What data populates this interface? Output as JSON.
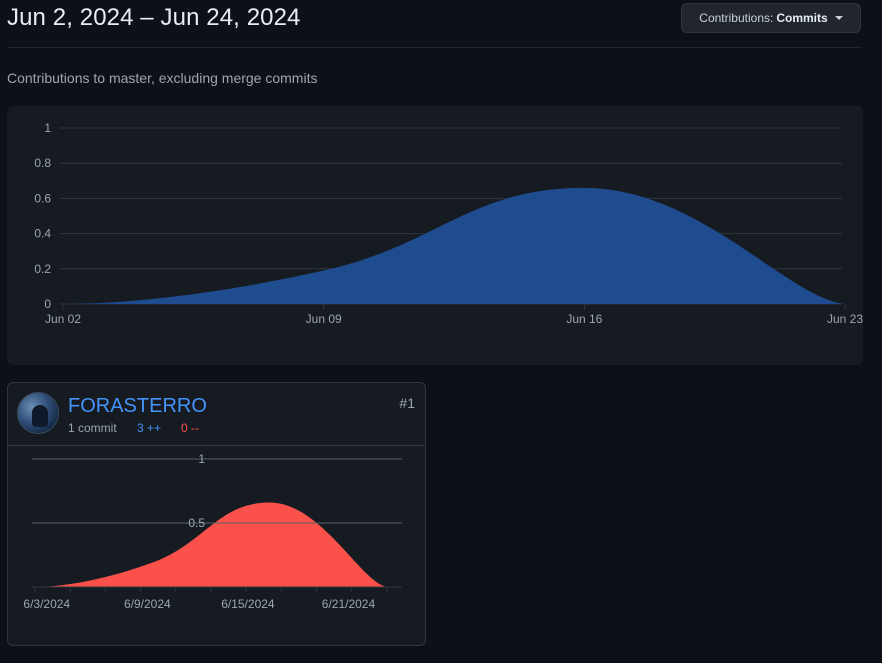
{
  "header": {
    "title": "Jun 2, 2024 – Jun 24, 2024",
    "contributions_prefix": "Contributions:",
    "contributions_value": "Commits"
  },
  "subtitle": "Contributions to master, excluding merge commits",
  "colors": {
    "main_area": "#1f4b8f",
    "user_area": "#fa524b",
    "grid": "#30363d",
    "tick_text": "#9da5b0"
  },
  "contributor": {
    "username": "FORASTERRO",
    "commits": "1 commit",
    "additions": "3 ++",
    "deletions": "0 --",
    "rank": "#1"
  },
  "chart_data": [
    {
      "type": "area",
      "title": "",
      "xlabel": "",
      "ylabel": "",
      "x": [
        "2024-06-02",
        "2024-06-09",
        "2024-06-16",
        "2024-06-23"
      ],
      "series": [
        {
          "values": [
            0,
            0.19,
            0.66,
            0
          ]
        }
      ],
      "x_ticks": [
        "Jun 02",
        "Jun 09",
        "Jun 16",
        "Jun 23"
      ],
      "y_ticks": [
        "0",
        "0.2",
        "0.4",
        "0.6",
        "0.8",
        "1"
      ],
      "xlim": [
        "2024-06-02",
        "2024-06-23"
      ],
      "ylim": [
        0,
        1
      ],
      "grid": true
    },
    {
      "type": "area",
      "title": "",
      "xlabel": "",
      "ylabel": "",
      "x": [
        "2024-06-02",
        "2024-06-09",
        "2024-06-16",
        "2024-06-23"
      ],
      "series": [
        {
          "values": [
            0,
            0.19,
            0.66,
            0
          ]
        }
      ],
      "x_ticks": [
        "6/3/2024",
        "6/9/2024",
        "6/15/2024",
        "6/21/2024"
      ],
      "y_ticks": [
        "0.5",
        "1"
      ],
      "xlim": [
        "2024-06-02",
        "2024-06-23"
      ],
      "ylim": [
        0,
        1
      ],
      "grid": true
    }
  ]
}
